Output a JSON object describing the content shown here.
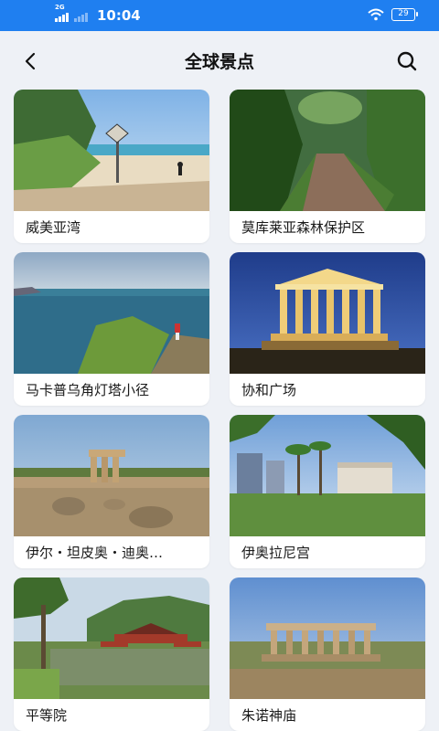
{
  "status_bar": {
    "network": "2G",
    "time": "10:04",
    "battery": "29",
    "wifi_icon": "wifi-icon",
    "signal_icon": "signal-icon"
  },
  "header": {
    "title": "全球景点",
    "back_icon": "chevron-left-icon",
    "search_icon": "search-icon"
  },
  "spots": [
    {
      "name": "威美亚湾"
    },
    {
      "name": "莫库莱亚森林保护区"
    },
    {
      "name": "马卡普乌角灯塔小径"
    },
    {
      "name": "协和广场"
    },
    {
      "name": "伊尔・坦皮奥・迪奥…"
    },
    {
      "name": "伊奥拉尼宫"
    },
    {
      "name": "平等院"
    },
    {
      "name": "朱诺神庙"
    }
  ],
  "colors": {
    "status_bar": "#1f7ff0",
    "background": "#eef1f6",
    "card": "#ffffff",
    "text": "#1a1a1a"
  }
}
